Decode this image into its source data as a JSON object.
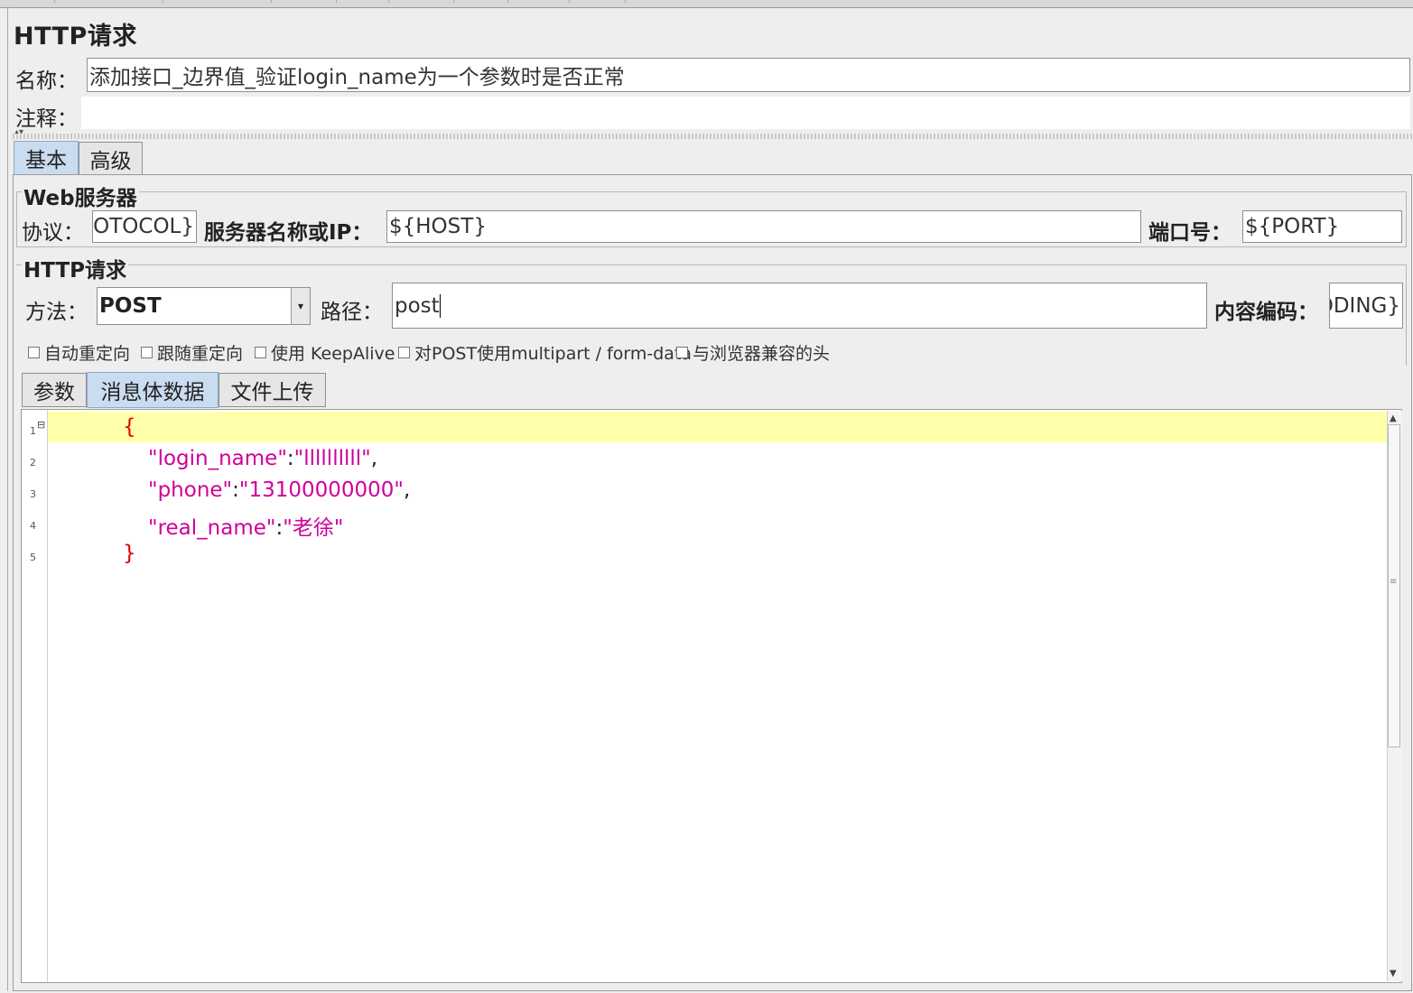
{
  "page": {
    "title": "HTTP请求"
  },
  "name_field": {
    "label": "名称：",
    "value": "添加接口_边界值_验证login_name为一个参数时是否正常"
  },
  "comment_field": {
    "label": "注释：",
    "value": ""
  },
  "tabs": [
    {
      "label": "基本",
      "active": true
    },
    {
      "label": "高级",
      "active": false
    }
  ],
  "web_server": {
    "title": "Web服务器",
    "protocol_label": "协议：",
    "protocol_value": "${PROTOCOL}",
    "server_label": "服务器名称或IP：",
    "server_value": "${HOST}",
    "port_label": "端口号：",
    "port_value": "${PORT}"
  },
  "http_request": {
    "title": "HTTP请求",
    "method_label": "方法：",
    "method_value": "POST",
    "path_label": "路径：",
    "path_value": "post",
    "encoding_label": "内容编码：",
    "encoding_value": "${ENCODING}"
  },
  "options": [
    {
      "label": "自动重定向",
      "checked": false
    },
    {
      "label": "跟随重定向",
      "checked": false
    },
    {
      "label": "使用 KeepAlive",
      "checked": false
    },
    {
      "label": "对POST使用multipart / form-data",
      "checked": false
    },
    {
      "label": "与浏览器兼容的头",
      "checked": false
    }
  ],
  "subtabs": [
    {
      "label": "参数",
      "active": false
    },
    {
      "label": "消息体数据",
      "active": true
    },
    {
      "label": "文件上传",
      "active": false
    }
  ],
  "body_editor": {
    "line_numbers": [
      "1",
      "2",
      "3",
      "4",
      "5"
    ],
    "fold_marker": "⊟",
    "lines": {
      "open_brace": "{",
      "login_key": "\"login_name\"",
      "login_value": "\"llllllllll\"",
      "phone_key": "\"phone\"",
      "phone_value": "\"13100000000\"",
      "real_key": "\"real_name\"",
      "real_value": "\"老徐\"",
      "close_brace": "}",
      "colon": ":",
      "comma": ","
    }
  },
  "colors": {
    "brace": "#e00000",
    "string": "#d0009a",
    "current_line": "#ffffaa",
    "active_tab": "#c9dcf0"
  }
}
